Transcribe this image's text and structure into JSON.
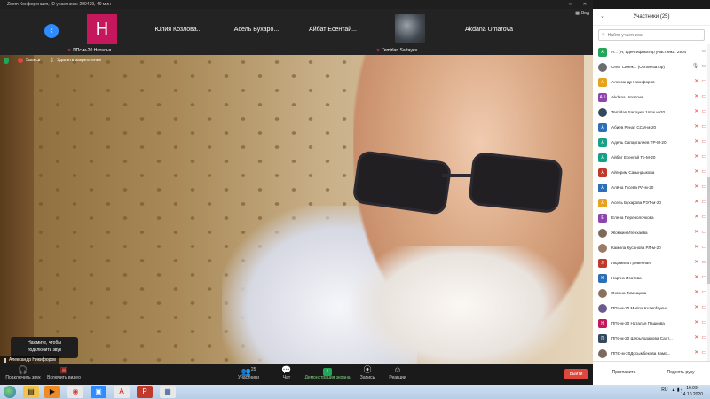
{
  "window": {
    "title": "Zoom Конференция, ID участника: 290439, 40 мин",
    "controls": [
      "–",
      "□",
      "✕"
    ]
  },
  "gallery": {
    "thumbs": [
      {
        "type": "avatar",
        "letter": "Н",
        "caption": "ППс-м-20 Наталья..."
      },
      {
        "type": "name",
        "name": "Юлия Козлова...",
        "caption": ""
      },
      {
        "type": "name",
        "name": "Асель Бухаро...",
        "caption": ""
      },
      {
        "type": "name",
        "name": "Айбат Есентай...",
        "caption": ""
      },
      {
        "type": "image",
        "caption": "Temirlan Sartayev ..."
      },
      {
        "type": "name",
        "name": "Akdana Umarova",
        "caption": ""
      }
    ],
    "view_label": "Вид"
  },
  "video": {
    "security_label": "",
    "record_label": "Запись",
    "unpin_label": "Удалить закрепление",
    "tooltip_line1": "Нажмите, чтобы",
    "tooltip_line2": "подключить звук",
    "speaker_name": "Александр Никифоров"
  },
  "toolbar": {
    "audio": "Подключить звук",
    "video": "Включить видео",
    "participants": "Участники",
    "participants_count": "25",
    "chat": "Чат",
    "share": "Демонстрация экрана",
    "record": "Запись",
    "reactions": "Реакции",
    "leave": "Выйти"
  },
  "panel": {
    "title": "Участники (25)",
    "search_placeholder": "Найти участника",
    "invite": "Пригласить",
    "raise_hand": "Поднять руку",
    "participants": [
      {
        "avatar": "A",
        "color": "#23a55a",
        "name": "A... (Я, идентификатор участника: 290439)",
        "me": true
      },
      {
        "avatar": "",
        "color": "#6d6d6d",
        "name": "Олег Синяк... (Организатор)",
        "host": true
      },
      {
        "avatar": "A",
        "color": "#e8a21b",
        "name": "Александр Никифоров"
      },
      {
        "avatar": "AU",
        "color": "#8e44ad",
        "name": "Akdana Umarova"
      },
      {
        "avatar": "",
        "color": "#34495e",
        "name": "Temirlan Sartayev 1mnк из20"
      },
      {
        "avatar": "А",
        "color": "#2d6fb5",
        "name": "Абиев Ренат ССМ-м-20"
      },
      {
        "avatar": "А",
        "color": "#16a085",
        "name": "Адель Сапаргалиев ТР-М-20"
      },
      {
        "avatar": "А",
        "color": "#16a085",
        "name": "Айбат Есенгай Тр-М-20"
      },
      {
        "avatar": "А",
        "color": "#c0392b",
        "name": "Айгерим Сагындыкова"
      },
      {
        "avatar": "А",
        "color": "#2d6fb5",
        "name": "Алёна Гусева РЛ-м-20"
      },
      {
        "avatar": "А",
        "color": "#e8a21b",
        "name": "Асель Бухарова РЭТ-м-20"
      },
      {
        "avatar": "Е",
        "color": "#8e44ad",
        "name": "Елена Переволочкова"
      },
      {
        "avatar": "",
        "color": "#7f6a5a",
        "name": "Жомкин Игенхаева"
      },
      {
        "avatar": "",
        "color": "#9a7b6a",
        "name": "Камила Кусанова РЛ-м-20"
      },
      {
        "avatar": "Л",
        "color": "#c0392b",
        "name": "Людмила Гривенная"
      },
      {
        "avatar": "Н",
        "color": "#2d6fb5",
        "name": "Наргиз Исатова"
      },
      {
        "avatar": "",
        "color": "#8a6f5d",
        "name": "Оксана Тимощина"
      },
      {
        "avatar": "",
        "color": "#6a5a8e",
        "name": "ППс-м-20 Marina Kuzenfayeva"
      },
      {
        "avatar": "Н",
        "color": "#c4175c",
        "name": "ППс-м-20 Наталья Пашкова"
      },
      {
        "avatar": "П",
        "color": "#34495e",
        "name": "ППс-м-20 Шерьяоданова Салт..."
      },
      {
        "avatar": "",
        "color": "#7a6a5e",
        "name": "ППС-м-20Досымбекова Камо..."
      }
    ]
  },
  "taskbar": {
    "lang": "RU",
    "time": "16:09",
    "date": "14.10.2020"
  }
}
